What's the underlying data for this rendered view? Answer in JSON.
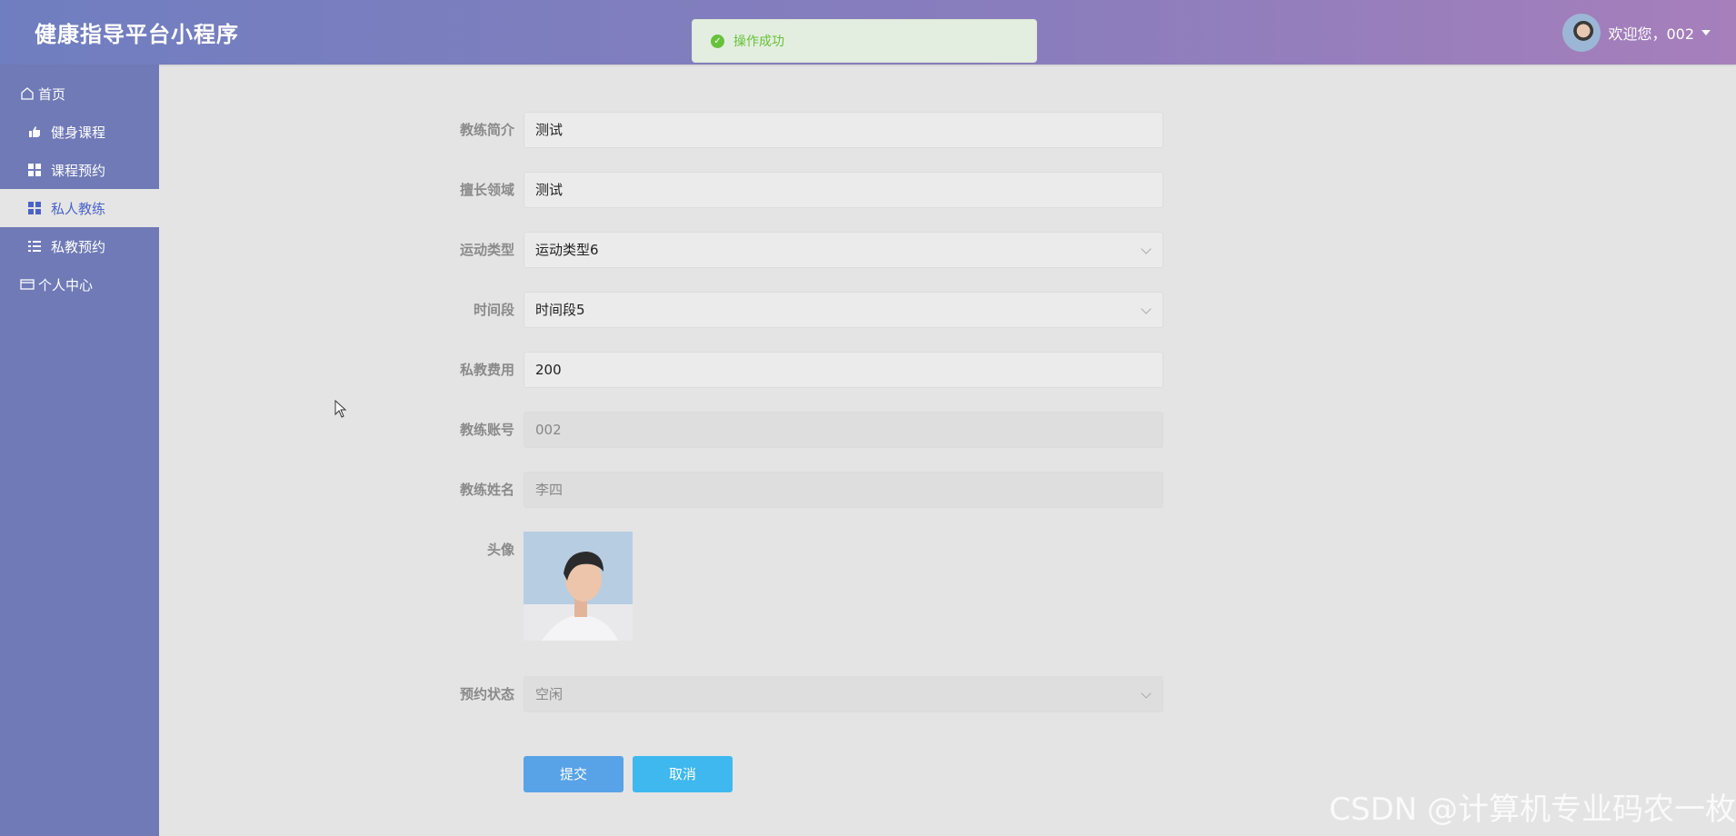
{
  "header": {
    "app_title": "健康指导平台小程序",
    "welcome_text": "欢迎您，002"
  },
  "toast": {
    "message": "操作成功"
  },
  "sidebar": {
    "items": [
      {
        "label": "首页",
        "icon": "home-icon"
      },
      {
        "label": "健身课程",
        "icon": "thumbs-up-icon"
      },
      {
        "label": "课程预约",
        "icon": "grid-icon"
      },
      {
        "label": "私人教练",
        "icon": "grid-icon"
      },
      {
        "label": "私教预约",
        "icon": "list-icon"
      },
      {
        "label": "个人中心",
        "icon": "card-icon"
      }
    ],
    "active_item": "私人教练"
  },
  "form": {
    "intro": {
      "label": "教练简介",
      "value": "测试"
    },
    "specialty": {
      "label": "擅长领域",
      "value": "测试"
    },
    "sport_type": {
      "label": "运动类型",
      "value": "运动类型6"
    },
    "time_slot": {
      "label": "时间段",
      "value": "时间段5"
    },
    "fee": {
      "label": "私教费用",
      "value": "200"
    },
    "account": {
      "label": "教练账号",
      "value": "002"
    },
    "name": {
      "label": "教练姓名",
      "value": "李四"
    },
    "avatar": {
      "label": "头像"
    },
    "status": {
      "label": "预约状态",
      "value": "空闲"
    },
    "submit_label": "提交",
    "cancel_label": "取消"
  },
  "watermark": "CSDN @计算机专业码农一枚",
  "colors": {
    "sidebar_bg": "#6f7ab6",
    "active_text": "#4a63c9",
    "submit_button": "#58a2e8",
    "cancel_button": "#3eb8ee",
    "toast_success": "#67c23a"
  }
}
